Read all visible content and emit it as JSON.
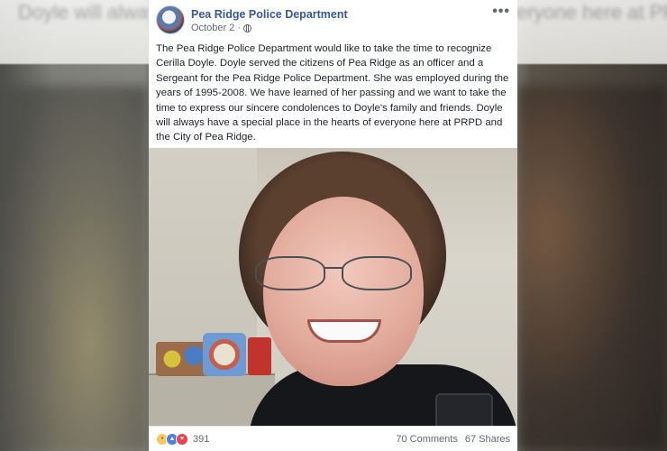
{
  "background_text": "Doyle will always have a special place in the hearts of everyone here at PRPD and the City of Pea Ridge.",
  "post": {
    "page_name": "Pea Ridge Police Department",
    "date": "October 2",
    "separator": "·",
    "more": "•••",
    "text": "The Pea Ridge Police Department would like to take the time to recognize Cerilla Doyle. Doyle served the citizens of Pea Ridge as an officer and a Sergeant for the Pea Ridge Police Department. She was employed during the years of 1995-2008. We have learned of her passing and we want to take the time to express our sincere condolences to Doyle's family and friends. Doyle will always have a special place in the hearts of everyone here at PRPD and the City of Pea Ridge.",
    "reaction_count": "391",
    "comments": "70 Comments",
    "shares": "67 Shares"
  }
}
